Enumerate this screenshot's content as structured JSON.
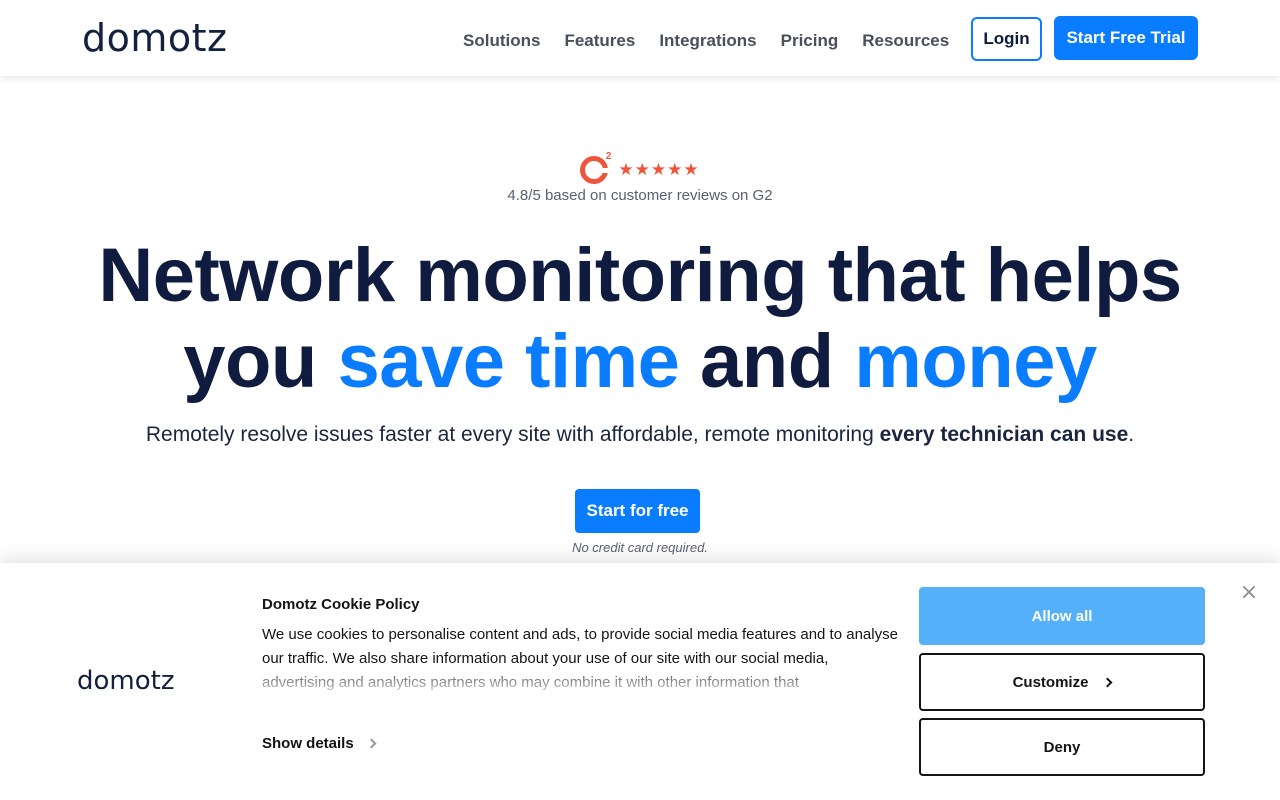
{
  "header": {
    "logo": "domotz",
    "nav": [
      "Solutions",
      "Features",
      "Integrations",
      "Pricing",
      "Resources"
    ],
    "login": "Login",
    "trial": "Start Free Trial"
  },
  "hero": {
    "g2_mark": "2",
    "rating_stars": 5,
    "rating_caption": "4.8/5 based on customer reviews on G2",
    "headline_1": "Network monitoring that helps",
    "headline_2_a": "you ",
    "headline_2_b": "save time",
    "headline_2_c": " and ",
    "headline_2_d": "money",
    "sub_a": "Remotely resolve issues faster at every site with affordable, remote monitoring ",
    "sub_b": "every technician can use",
    "sub_c": ".",
    "cta": "Start for free",
    "note": "No credit card required."
  },
  "cookie": {
    "logo": "domotz",
    "title": "Domotz Cookie Policy",
    "text": "We use cookies to personalise content and ads, to provide social media features and to analyse our traffic. We also share information about your use of our site with our social media, advertising and analytics partners who may combine it with other information that",
    "show_details": "Show details",
    "allow_all": "Allow all",
    "customize": "Customize",
    "deny": "Deny"
  },
  "colors": {
    "brand_blue": "#0a7cff",
    "navy": "#0f1c3f",
    "g2_red": "#f0553c",
    "allow_button": "#54b0f8"
  }
}
